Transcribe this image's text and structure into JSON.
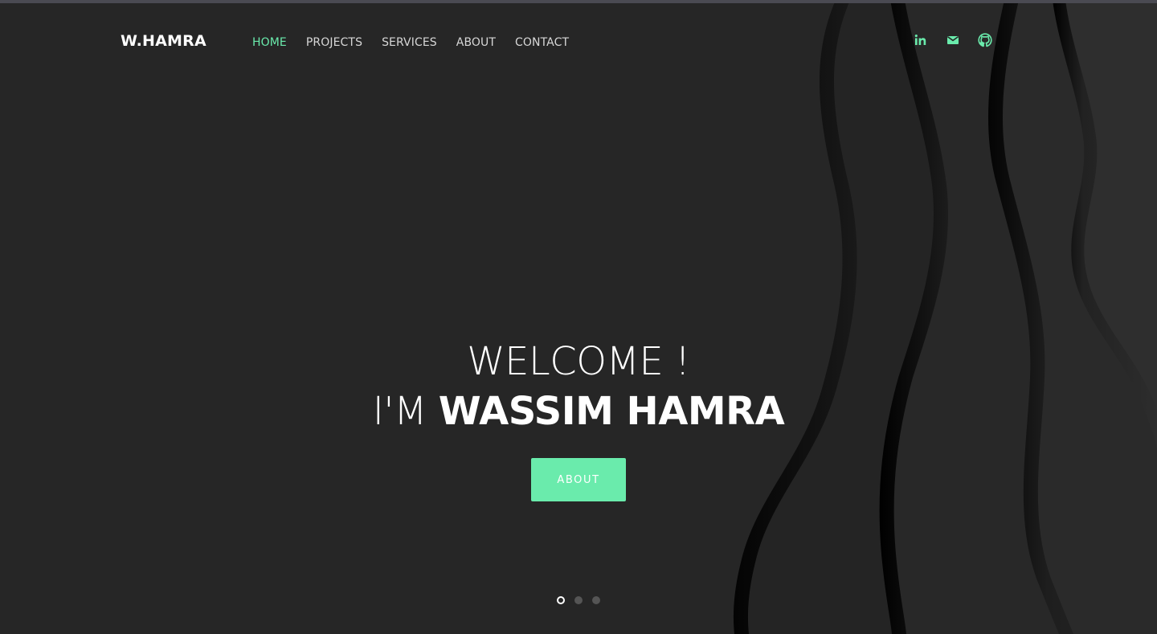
{
  "nav": {
    "brand": "W.HAMRA",
    "links": [
      {
        "label": "HOME",
        "active": true
      },
      {
        "label": "PROJECTS",
        "active": false
      },
      {
        "label": "SERVICES",
        "active": false
      },
      {
        "label": "ABOUT",
        "active": false
      },
      {
        "label": "CONTACT",
        "active": false
      }
    ],
    "social": [
      {
        "icon": "linkedin-icon"
      },
      {
        "icon": "mail-icon"
      },
      {
        "icon": "github-icon"
      }
    ]
  },
  "hero": {
    "line1": "WELCOME !",
    "line2_prefix": "I'M ",
    "line2_name": "WASSIM HAMRA",
    "button_label": "ABOUT"
  },
  "carousel": {
    "slide_count": 3,
    "active_index": 0
  },
  "colors": {
    "accent": "#6aebac",
    "background": "#252525",
    "text": "#ffffff"
  }
}
